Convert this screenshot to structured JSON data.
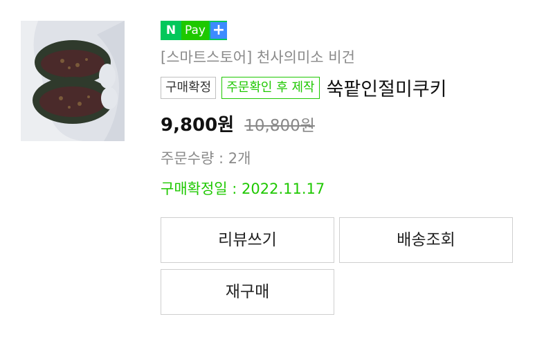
{
  "npay": {
    "n_label": "N",
    "pay_label": "Pay",
    "plus_label": "+"
  },
  "store_name": "[스마트스토어] 천사의미소 비건",
  "badges": {
    "confirmed": "구매확정",
    "made_to_order": "주문확인 후 제작"
  },
  "product_title": "쑥팥인절미쿠키",
  "price": "9,800원",
  "original_price": "10,800원",
  "quantity_text": "주문수량 : 2개",
  "confirm_date_text": "구매확정일 : 2022.11.17",
  "buttons": {
    "review": "리뷰쓰기",
    "tracking": "배송조회",
    "reorder": "재구매"
  },
  "colors": {
    "naver_green": "#1ec800",
    "plus_blue": "#3d8bff",
    "gray_text": "#8a8a8a"
  }
}
